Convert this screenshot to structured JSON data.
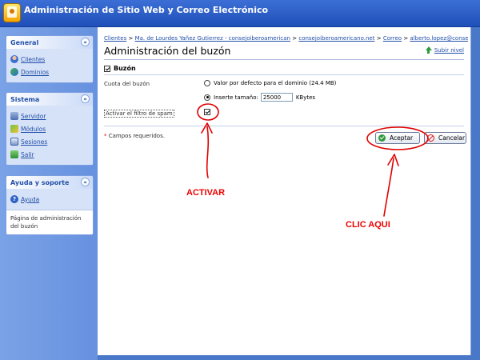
{
  "app": {
    "title": "Administración de Sitio Web y Correo Electrónico"
  },
  "sidebar": {
    "general": {
      "title": "General",
      "items": [
        {
          "label": "Clientes",
          "icon": "user-icon"
        },
        {
          "label": "Dominios",
          "icon": "domain-icon"
        }
      ]
    },
    "sistema": {
      "title": "Sistema",
      "items": [
        {
          "label": "Servidor",
          "icon": "server-icon"
        },
        {
          "label": "Módulos",
          "icon": "modules-icon"
        },
        {
          "label": "Sesiones",
          "icon": "sessions-icon"
        },
        {
          "label": "Salir",
          "icon": "exit-icon"
        }
      ]
    },
    "ayuda": {
      "title": "Ayuda y soporte",
      "item": {
        "label": "Ayuda",
        "icon": "help-icon"
      },
      "description": "Página de administración del buzón"
    }
  },
  "breadcrumb": {
    "items": [
      "Clientes",
      "Ma. de Lourdes Yañez Gutierrez - consejoiberoamerican",
      "consejoiberoamericano.net",
      "Correo",
      "alberto.lopez@consejoiberoamericano.net"
    ],
    "separator": ">"
  },
  "page": {
    "title": "Administración del buzón",
    "up_level": "Subir nivel"
  },
  "mailbox": {
    "section_label": "Buzón",
    "section_checked": true,
    "quota_label": "Cuota del buzón",
    "option_default": "Valor por defecto para el dominio (24.4 MB)",
    "option_size": "Inserte tamaño:",
    "size_value": "25000",
    "size_unit": "KBytes",
    "selected_option": "size",
    "spam_label": "Activar el filtro de spam",
    "spam_checked": true
  },
  "form": {
    "required_star": "*",
    "required_note": "Campos requeridos.",
    "accept_label": "Aceptar",
    "cancel_label": "Cancelar"
  },
  "annotations": {
    "activate": "ACTIVAR",
    "click_here": "CLIC AQUI",
    "color": "#e00000"
  }
}
